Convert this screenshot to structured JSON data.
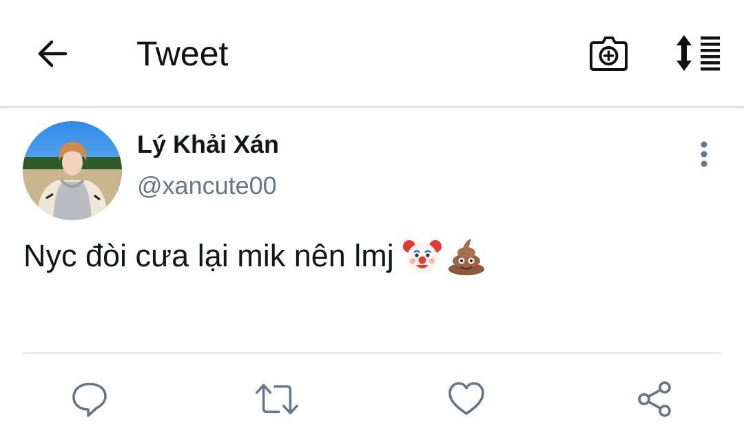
{
  "app_bar": {
    "title": "Tweet",
    "back_icon": "arrow-left-icon",
    "camera_icon": "camera-plus-icon",
    "sort_icon": "sort-list-icon"
  },
  "tweet": {
    "author": {
      "display_name": "Lý Khải Xán",
      "handle": "@xancute00"
    },
    "text": "Nyc đòi cưa lại mik nên lmj",
    "emojis": [
      "clown-face-emoji",
      "pile-of-poo-emoji"
    ]
  },
  "actions": {
    "reply_icon": "reply-bubble-icon",
    "retweet_icon": "retweet-icon",
    "like_icon": "heart-icon",
    "share_icon": "share-icon"
  },
  "colors": {
    "text_primary": "#14171a",
    "text_secondary": "#657786",
    "icon_gray": "#657786",
    "divider": "#e1e8ed"
  }
}
